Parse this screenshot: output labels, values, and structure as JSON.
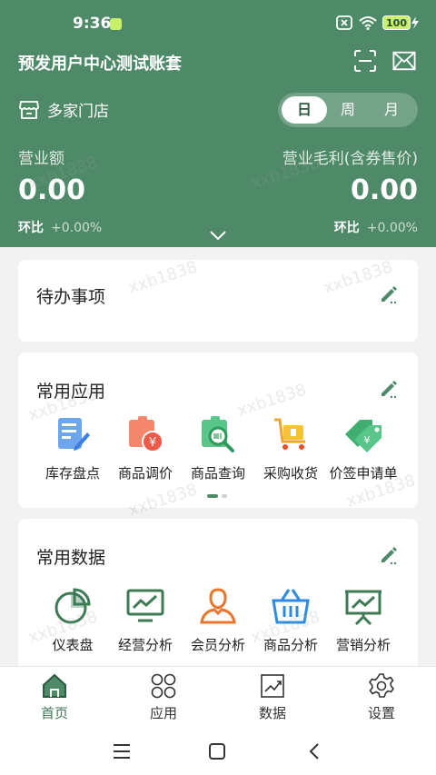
{
  "statusbar": {
    "time": "9:36",
    "battery": "100"
  },
  "header": {
    "account_name": "预发用户中心测试账套",
    "store_label": "多家门店",
    "period_options": [
      "日",
      "周",
      "月"
    ],
    "period_selected": "日"
  },
  "kpi": {
    "revenue_label": "营业额",
    "revenue_value": "0.00",
    "revenue_cmp_label": "环比",
    "revenue_cmp_value": "+0.00%",
    "profit_label": "营业毛利(含券售价)",
    "profit_value": "0.00",
    "profit_cmp_label": "环比",
    "profit_cmp_value": "+0.00%"
  },
  "todo": {
    "title": "待办事项"
  },
  "common_apps": {
    "title": "常用应用",
    "items": [
      {
        "label": "库存盘点",
        "icon": "inventory-check-icon"
      },
      {
        "label": "商品调价",
        "icon": "price-adjust-icon"
      },
      {
        "label": "商品查询",
        "icon": "product-query-icon"
      },
      {
        "label": "采购收货",
        "icon": "purchase-receive-icon"
      },
      {
        "label": "价签申请单",
        "icon": "price-tag-request-icon"
      }
    ]
  },
  "common_data": {
    "title": "常用数据",
    "items": [
      {
        "label": "仪表盘",
        "icon": "dashboard-icon"
      },
      {
        "label": "经营分析",
        "icon": "business-analysis-icon"
      },
      {
        "label": "会员分析",
        "icon": "member-analysis-icon"
      },
      {
        "label": "商品分析",
        "icon": "product-analysis-icon"
      },
      {
        "label": "营销分析",
        "icon": "marketing-analysis-icon"
      }
    ]
  },
  "tabs": [
    {
      "label": "首页",
      "icon": "home-icon",
      "active": true
    },
    {
      "label": "应用",
      "icon": "apps-icon",
      "active": false
    },
    {
      "label": "数据",
      "icon": "data-chart-icon",
      "active": false
    },
    {
      "label": "设置",
      "icon": "settings-gear-icon",
      "active": false
    }
  ],
  "watermark": "xxb1838",
  "colors": {
    "brand": "#4e8a68",
    "accent": "#3d7a55",
    "background": "#f2f2f2"
  }
}
